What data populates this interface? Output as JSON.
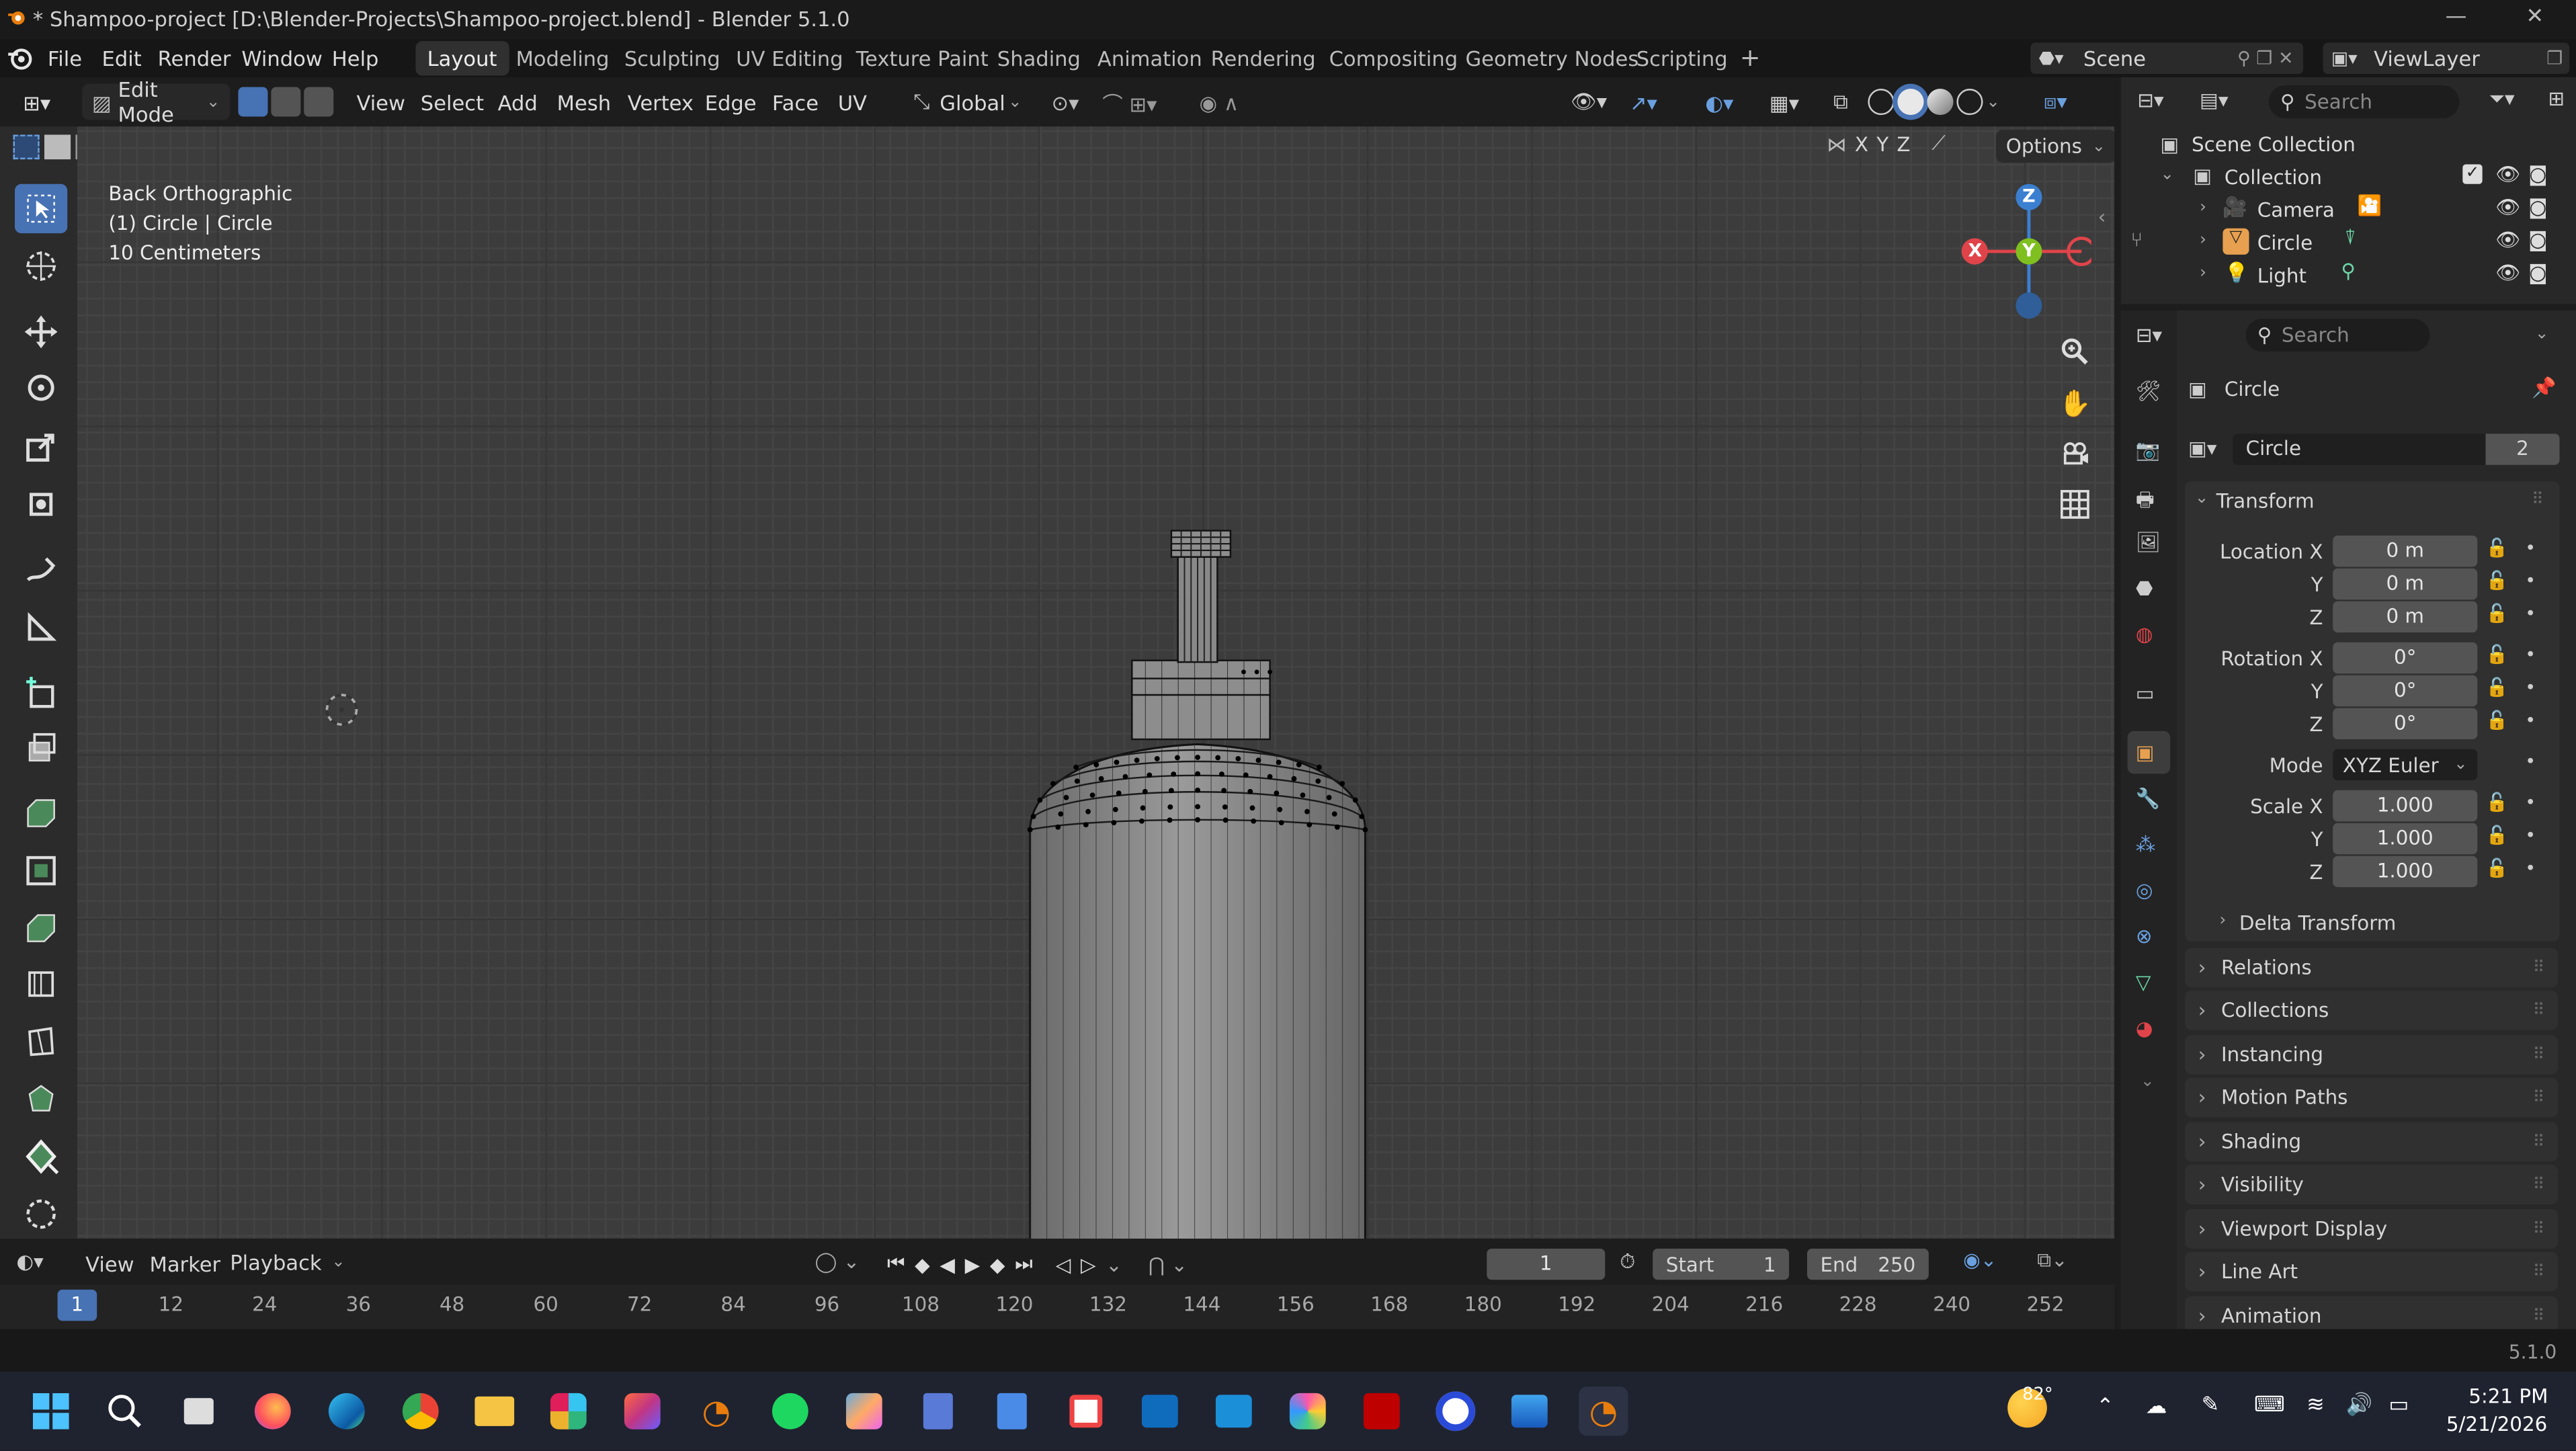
{
  "window": {
    "title": "* Shampoo-project [D:\\Blender-Projects\\Shampoo-project.blend] - Blender 5.1.0",
    "controls": [
      "—",
      "❐",
      "✕"
    ]
  },
  "menubar": {
    "menus": [
      "File",
      "Edit",
      "Render",
      "Window",
      "Help"
    ],
    "workspaces": [
      "Layout",
      "Modeling",
      "Sculpting",
      "UV Editing",
      "Texture Paint",
      "Shading",
      "Animation",
      "Rendering",
      "Compositing",
      "Geometry Nodes",
      "Scripting"
    ],
    "active_workspace": "Layout",
    "scene": "Scene",
    "view_layer": "ViewLayer"
  },
  "viewport_header": {
    "mode": "Edit Mode",
    "menus": [
      "View",
      "Select",
      "Add",
      "Mesh",
      "Vertex",
      "Edge",
      "Face",
      "UV"
    ],
    "orientation": "Global",
    "axes": [
      "X",
      "Y",
      "Z"
    ],
    "options": "Options"
  },
  "viewport": {
    "view_name": "Back Orthographic",
    "object_info": "(1) Circle | Circle",
    "scale": "10 Centimeters",
    "gizmo": {
      "x": "X",
      "y": "Y",
      "z": "Z",
      "colors": {
        "x": "#e0444a",
        "y": "#7fbf1f",
        "z": "#3b7fd1"
      }
    }
  },
  "timeline": {
    "menus": [
      "View",
      "Marker",
      "Playback"
    ],
    "current_frame": "1",
    "start_label": "Start",
    "start": "1",
    "end_label": "End",
    "end": "250",
    "ticks": [
      "1",
      "12",
      "24",
      "36",
      "48",
      "60",
      "72",
      "84",
      "96",
      "108",
      "120",
      "132",
      "144",
      "156",
      "168",
      "180",
      "192",
      "204",
      "216",
      "228",
      "240",
      "252"
    ]
  },
  "outliner": {
    "search_placeholder": "Search",
    "scene_collection": "Scene Collection",
    "collection": "Collection",
    "items": [
      "Camera",
      "Circle",
      "Light"
    ]
  },
  "properties": {
    "search_placeholder": "Search",
    "object_name": "Circle",
    "data_name": "Circle",
    "data_users": "2",
    "transform": {
      "title": "Transform",
      "location_label": "Location X",
      "location": [
        "0 m",
        "0 m",
        "0 m"
      ],
      "rotation_label": "Rotation X",
      "rotation": [
        "0°",
        "0°",
        "0°"
      ],
      "mode_label": "Mode",
      "mode": "XYZ Euler",
      "scale_label": "Scale X",
      "scale": [
        "1.000",
        "1.000",
        "1.000"
      ],
      "y_label": "Y",
      "z_label": "Z",
      "delta": "Delta Transform"
    },
    "panels": [
      "Relations",
      "Collections",
      "Instancing",
      "Motion Paths",
      "Shading",
      "Visibility",
      "Viewport Display",
      "Line Art",
      "Animation"
    ]
  },
  "statusbar": {
    "version": "5.1.0"
  },
  "taskbar": {
    "weather": "82°",
    "time": "5:21 PM",
    "date": "5/21/2026"
  }
}
